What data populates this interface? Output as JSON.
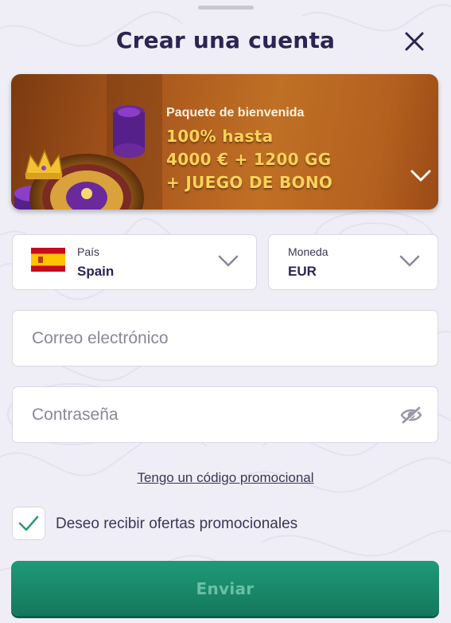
{
  "modal": {
    "title": "Crear una cuenta"
  },
  "promo": {
    "subtitle": "Paquete de bienvenida",
    "lines": [
      "100% hasta",
      "4000 € + 1200 GG",
      "+ JUEGO DE BONO"
    ]
  },
  "country": {
    "label": "País",
    "value": "Spain",
    "flag_colors": {
      "red": "#c60b1e",
      "yellow": "#ffc400"
    }
  },
  "currency": {
    "label": "Moneda",
    "value": "EUR"
  },
  "email": {
    "placeholder": "Correo electrónico",
    "value": ""
  },
  "password": {
    "placeholder": "Contraseña",
    "value": "",
    "toggle_icon": "eye-off-icon"
  },
  "promo_code_link": "Tengo un código promocional",
  "marketing": {
    "checked": true,
    "label": "Deseo recibir ofertas promocionales"
  },
  "submit": {
    "label": "Enviar"
  },
  "colors": {
    "title": "#2c2452",
    "accent_green": "#1f9a78",
    "promo_gold": "#ffd35a",
    "promo_bg": "#b4601f",
    "check_green": "#2f9a73"
  }
}
